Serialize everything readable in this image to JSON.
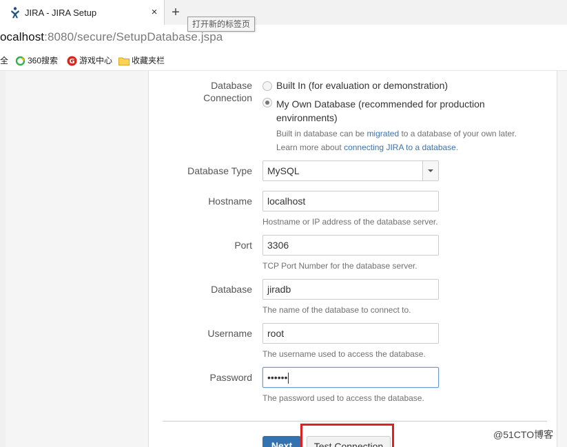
{
  "browser": {
    "tab_title": "JIRA - JIRA Setup",
    "tab_close": "×",
    "new_tab_symbol": "+",
    "new_tab_tooltip": "打开新的标签页",
    "url_host": "ocalhost",
    "url_rest": ":8080/secure/SetupDatabase.jspa",
    "bookmarks": [
      {
        "label": "全",
        "icon": "partial-icon"
      },
      {
        "label": "360搜索",
        "icon": "360-search-icon"
      },
      {
        "label": "游戏中心",
        "icon": "game-center-icon"
      },
      {
        "label": "收藏夹栏",
        "icon": "folder-icon"
      }
    ]
  },
  "form": {
    "connection": {
      "label_line1": "Database",
      "label_line2": "Connection",
      "option_builtin": "Built In (for evaluation or demonstration)",
      "option_own_line1": "My Own Database (recommended for production",
      "option_own_line2": "environments)",
      "selected": "own",
      "help_line1_pre": "Built in database can be ",
      "help_line1_link": "migrated",
      "help_line1_post": " to a database of your own later.",
      "help_line2_pre": "Learn more about ",
      "help_line2_link": "connecting JIRA to a database",
      "help_line2_post": "."
    },
    "database_type": {
      "label": "Database Type",
      "value": "MySQL"
    },
    "hostname": {
      "label": "Hostname",
      "value": "localhost",
      "help": "Hostname or IP address of the database server."
    },
    "port": {
      "label": "Port",
      "value": "3306",
      "help": "TCP Port Number for the database server."
    },
    "database": {
      "label": "Database",
      "value": "jiradb",
      "help": "The name of the database to connect to."
    },
    "username": {
      "label": "Username",
      "value": "root",
      "help": "The username used to access the database."
    },
    "password": {
      "label": "Password",
      "value": "••••••",
      "help": "The password used to access the database."
    },
    "buttons": {
      "next": "Next",
      "test_connection": "Test Connection"
    }
  },
  "watermark": "@51CTO博客",
  "colors": {
    "link": "#3b73af",
    "primary_button": "#3572b0",
    "highlight_box": "#e02020"
  }
}
